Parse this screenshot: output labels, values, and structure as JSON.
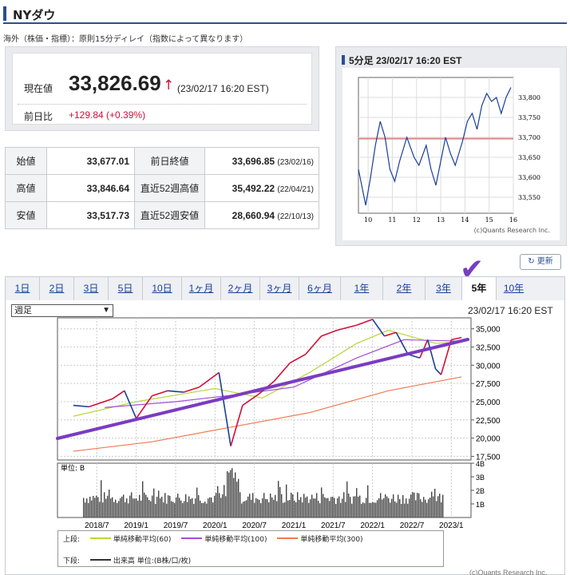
{
  "header": {
    "title": "NYダウ"
  },
  "note": "海外（株価・指標）：原則15分ディレイ（指数によって異なります）",
  "quote": {
    "current_label": "現在値",
    "current_value": "33,826.69",
    "arrow": "↑",
    "current_time": "(23/02/17 16:20 EST)",
    "change_label": "前日比",
    "change_value": "+129.84 (+0.39%)"
  },
  "stats": {
    "rows": [
      {
        "label": "始値",
        "value": "33,677.01",
        "label2": "前日終値",
        "value2": "33,696.85",
        "date2": "(23/02/16)"
      },
      {
        "label": "高値",
        "value": "33,846.64",
        "label2": "直近52週高値",
        "value2": "35,492.22",
        "date2": "(22/04/21)"
      },
      {
        "label": "安値",
        "value": "33,517.73",
        "label2": "直近52週安値",
        "value2": "28,660.94",
        "date2": "(22/10/13)"
      }
    ]
  },
  "intraday": {
    "title": "5分足 23/02/17 16:20 EST",
    "credit": "(c)Quants Research Inc."
  },
  "refresh_label": "更新",
  "tabs": [
    {
      "label": "1日"
    },
    {
      "label": "2日"
    },
    {
      "label": "3日"
    },
    {
      "label": "5日"
    },
    {
      "label": "10日"
    },
    {
      "label": "1ヶ月"
    },
    {
      "label": "2ヶ月"
    },
    {
      "label": "3ヶ月"
    },
    {
      "label": "6ヶ月"
    },
    {
      "label": "1年"
    },
    {
      "label": "2年"
    },
    {
      "label": "3年"
    },
    {
      "label": "5年"
    },
    {
      "label": "10年"
    }
  ],
  "active_tab": "5年",
  "main_chart": {
    "period_select": "週足",
    "timestamp": "23/02/17 16:20 EST",
    "volume_unit_label": "単位: B",
    "legend": {
      "upper_label": "上段:",
      "ma60": "単純移動平均(60)",
      "ma100": "単純移動平均(100)",
      "ma300": "単純移動平均(300)",
      "lower_label": "下段:",
      "volume": "出来高 単位:(B株/口/枚)"
    },
    "credit": "(c)Quants Research Inc."
  },
  "colors": {
    "accent": "#2a4f91",
    "up": "#d0103a",
    "down": "#1a3e99",
    "ma60": "#b8d63a",
    "ma100": "#a24fd6",
    "ma300": "#f07a50",
    "annotation": "#7a3cc2"
  },
  "chart_data": [
    {
      "type": "line",
      "title": "5分足 23/02/17 16:20 EST",
      "x_ticks": [
        "10",
        "11",
        "12",
        "13",
        "14",
        "15",
        "16"
      ],
      "y_ticks": [
        33550,
        33600,
        33650,
        33700,
        33750,
        33800
      ],
      "ylim": [
        33510,
        33850
      ],
      "reference_line": 33696.85,
      "series": [
        {
          "values": [
            [
              9.6,
              33620
            ],
            [
              9.8,
              33560
            ],
            [
              9.9,
              33530
            ],
            [
              10.1,
              33600
            ],
            [
              10.3,
              33680
            ],
            [
              10.5,
              33740
            ],
            [
              10.7,
              33700
            ],
            [
              10.9,
              33620
            ],
            [
              11.1,
              33590
            ],
            [
              11.3,
              33640
            ],
            [
              11.6,
              33700
            ],
            [
              11.9,
              33650
            ],
            [
              12.1,
              33630
            ],
            [
              12.4,
              33680
            ],
            [
              12.6,
              33620
            ],
            [
              12.8,
              33580
            ],
            [
              13.0,
              33640
            ],
            [
              13.2,
              33700
            ],
            [
              13.4,
              33660
            ],
            [
              13.6,
              33630
            ],
            [
              13.9,
              33690
            ],
            [
              14.1,
              33740
            ],
            [
              14.3,
              33760
            ],
            [
              14.5,
              33720
            ],
            [
              14.7,
              33780
            ],
            [
              14.9,
              33810
            ],
            [
              15.1,
              33790
            ],
            [
              15.3,
              33800
            ],
            [
              15.5,
              33760
            ],
            [
              15.7,
              33800
            ],
            [
              15.9,
              33825
            ]
          ]
        }
      ]
    },
    {
      "type": "line",
      "title": "",
      "x_ticks": [
        "2018/7",
        "2019/1",
        "2019/7",
        "2020/1",
        "2020/7",
        "2021/1",
        "2021/7",
        "2022/1",
        "2022/7",
        "2023/1"
      ],
      "y_ticks": [
        17500,
        20000,
        22500,
        25000,
        27500,
        30000,
        32500,
        35000
      ],
      "ylim": [
        17000,
        36500
      ],
      "series": [
        {
          "name": "NYダウ",
          "values": [
            [
              2018.2,
              24500
            ],
            [
              2018.4,
              24300
            ],
            [
              2018.7,
              25400
            ],
            [
              2018.85,
              26500
            ],
            [
              2019.0,
              22700
            ],
            [
              2019.2,
              25800
            ],
            [
              2019.4,
              26500
            ],
            [
              2019.6,
              26300
            ],
            [
              2019.8,
              27000
            ],
            [
              2020.05,
              29000
            ],
            [
              2020.2,
              18900
            ],
            [
              2020.35,
              24500
            ],
            [
              2020.55,
              26000
            ],
            [
              2020.75,
              27800
            ],
            [
              2020.95,
              30300
            ],
            [
              2021.15,
              31500
            ],
            [
              2021.35,
              34000
            ],
            [
              2021.55,
              34800
            ],
            [
              2021.8,
              35500
            ],
            [
              2022.0,
              36300
            ],
            [
              2022.15,
              34000
            ],
            [
              2022.3,
              34500
            ],
            [
              2022.45,
              31500
            ],
            [
              2022.6,
              31000
            ],
            [
              2022.7,
              33500
            ],
            [
              2022.8,
              29500
            ],
            [
              2022.87,
              28700
            ],
            [
              2023.0,
              33500
            ],
            [
              2023.13,
              33800
            ]
          ]
        },
        {
          "name": "単純移動平均(60)",
          "values": [
            [
              2018.2,
              23000
            ],
            [
              2019.0,
              25000
            ],
            [
              2020.0,
              26800
            ],
            [
              2020.6,
              25500
            ],
            [
              2021.2,
              29000
            ],
            [
              2021.8,
              33000
            ],
            [
              2022.2,
              34800
            ],
            [
              2022.8,
              33000
            ],
            [
              2023.13,
              33200
            ]
          ]
        },
        {
          "name": "単純移動平均(100)",
          "values": [
            [
              2018.6,
              24200
            ],
            [
              2019.5,
              25000
            ],
            [
              2020.3,
              26000
            ],
            [
              2021.0,
              27000
            ],
            [
              2021.8,
              31000
            ],
            [
              2022.4,
              33500
            ],
            [
              2023.13,
              33300
            ]
          ]
        },
        {
          "name": "単純移動平均(300)",
          "values": [
            [
              2018.2,
              18200
            ],
            [
              2019.2,
              19500
            ],
            [
              2020.2,
              21500
            ],
            [
              2021.2,
              23500
            ],
            [
              2022.2,
              26500
            ],
            [
              2023.13,
              28400
            ]
          ]
        }
      ]
    },
    {
      "type": "bar",
      "title": "",
      "y_ticks": [
        "1B",
        "2B",
        "3B",
        "4B"
      ],
      "ylim": [
        0,
        4
      ]
    }
  ]
}
